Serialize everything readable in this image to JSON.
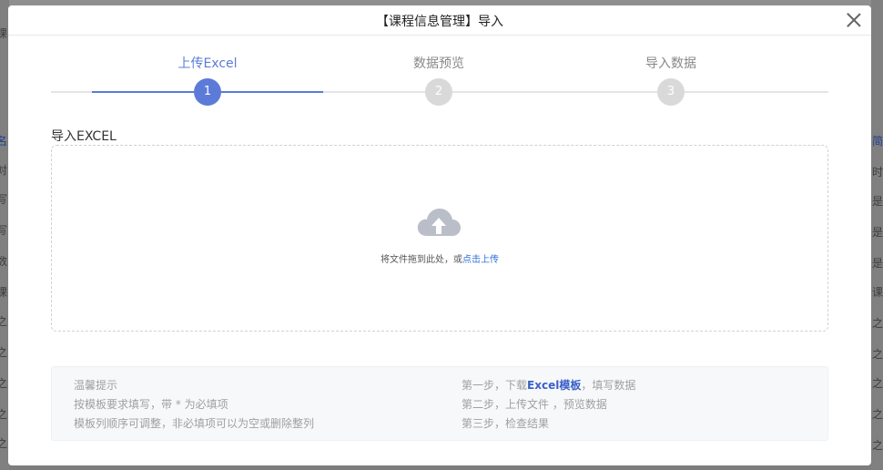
{
  "modal": {
    "title": "【课程信息管理】导入"
  },
  "steps": [
    {
      "label": "上传Excel",
      "number": "1",
      "active": true
    },
    {
      "label": "数据预览",
      "number": "2",
      "active": false
    },
    {
      "label": "导入数据",
      "number": "3",
      "active": false
    }
  ],
  "upload": {
    "section_label": "导入EXCEL",
    "prompt_text": "将文件拖到此处，或",
    "link_text": "点击上传",
    "icon": "cloud-upload-icon"
  },
  "tips": {
    "title": "温馨提示",
    "line1": "按模板要求填写，带 * 为必填项",
    "line2": "模板列顺序可调整，非必填项可以为空或删除整列",
    "step1_prefix": "第一步，下载",
    "step1_link": "Excel模板",
    "step1_suffix": "，填写数据",
    "step2": "第二步，上传文件 ，预览数据",
    "step3": "第三步，检查结果"
  },
  "background": {
    "left_fragments": [
      "课",
      "名",
      "对",
      "写",
      "写",
      "数",
      "课",
      "之",
      "之",
      "之",
      "之",
      "之"
    ],
    "right_fragments": [
      "简介",
      "时计",
      "是职",
      "是介",
      "是球",
      "课酣",
      "之球",
      "之球",
      "之球",
      "之球",
      "之球"
    ]
  },
  "colors": {
    "accent": "#5c7bd9",
    "link": "#2f6fd9",
    "inactive_step": "#d9d9d9"
  }
}
